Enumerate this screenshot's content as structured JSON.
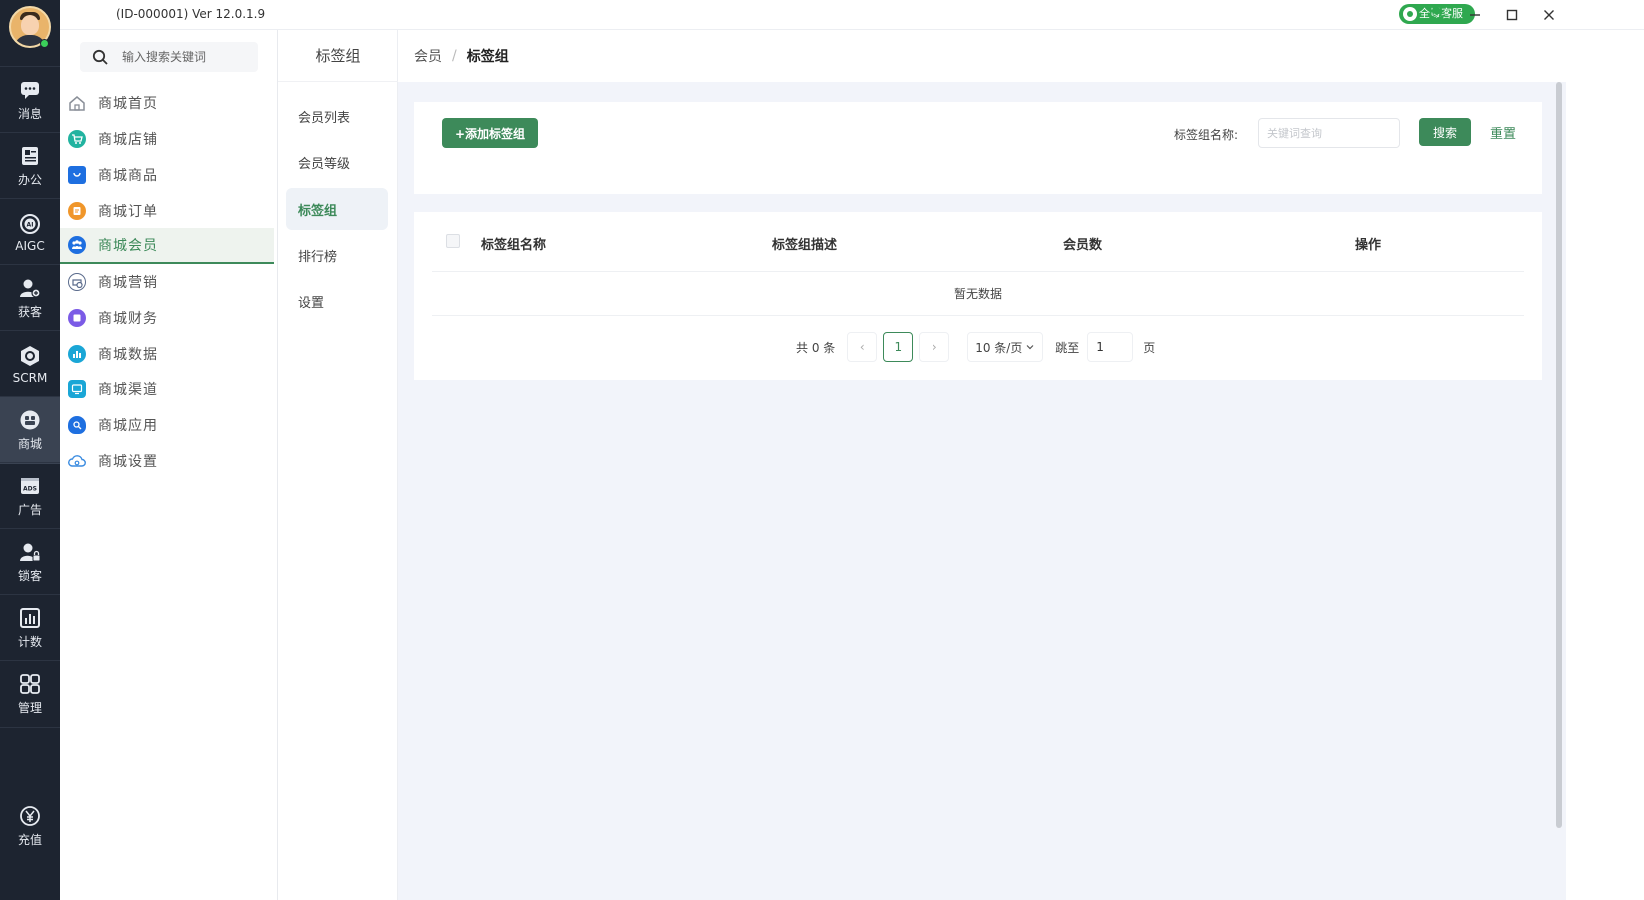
{
  "titlebar": {
    "version": "(ID-000001)  Ver 12.0.1.9",
    "service_badge": "全域客服"
  },
  "rail": {
    "items": [
      {
        "label": "消息",
        "icon": "message-icon"
      },
      {
        "label": "办公",
        "icon": "office-icon"
      },
      {
        "label": "AIGC",
        "icon": "aigc-icon"
      },
      {
        "label": "获客",
        "icon": "acquire-customer-icon"
      },
      {
        "label": "SCRM",
        "icon": "scrm-icon"
      },
      {
        "label": "商城",
        "icon": "mall-icon"
      },
      {
        "label": "广告",
        "icon": "ads-icon"
      },
      {
        "label": "锁客",
        "icon": "lock-customer-icon"
      },
      {
        "label": "计数",
        "icon": "stats-icon"
      },
      {
        "label": "管理",
        "icon": "grid-icon"
      }
    ],
    "active_index": 5,
    "recharge_label": "充值"
  },
  "nav": {
    "search_placeholder": "输入搜索关键词",
    "items": [
      {
        "label": "商城首页",
        "color": "#8a8f98"
      },
      {
        "label": "商城店铺",
        "color": "#22b3a0"
      },
      {
        "label": "商城商品",
        "color": "#1e6fe0"
      },
      {
        "label": "商城订单",
        "color": "#f0962a"
      },
      {
        "label": "商城会员",
        "color": "#1e6fe0"
      },
      {
        "label": "商城营销",
        "color": "#5a6b8c"
      },
      {
        "label": "商城财务",
        "color": "#7b5be6"
      },
      {
        "label": "商城数据",
        "color": "#1aa6d6"
      },
      {
        "label": "商城渠道",
        "color": "#1aa6d6"
      },
      {
        "label": "商城应用",
        "color": "#1e6fe0"
      },
      {
        "label": "商城设置",
        "color": "#3a8be0"
      }
    ],
    "active_index": 4
  },
  "submenu": {
    "title": "标签组",
    "items": [
      "会员列表",
      "会员等级",
      "标签组",
      "排行榜",
      "设置"
    ],
    "active_index": 2
  },
  "breadcrumb": {
    "parent": "会员",
    "separator": "/",
    "current": "标签组"
  },
  "toolbar": {
    "add_label": "+添加标签组",
    "filter_label": "标签组名称:",
    "filter_placeholder": "关键词查询",
    "search_label": "搜索",
    "reset_label": "重置"
  },
  "table": {
    "columns": [
      "标签组名称",
      "标签组描述",
      "会员数",
      "操作"
    ],
    "rows": [],
    "empty_text": "暂无数据"
  },
  "pagination": {
    "total_text": "共 0 条",
    "prev": "‹",
    "current_page": "1",
    "next": "›",
    "page_size": "10 条/页",
    "jump_label": "跳至",
    "jump_value": "1",
    "page_suffix": "页"
  },
  "colors": {
    "brand_green": "#3d8a5a",
    "rail_bg": "#1d2430",
    "main_bg": "#f2f4fa",
    "badge_green": "#2fa84f"
  }
}
